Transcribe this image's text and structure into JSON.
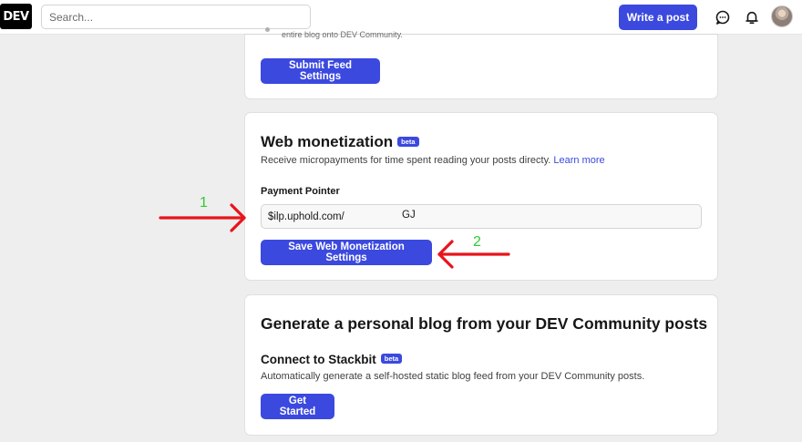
{
  "header": {
    "logo": "DEV",
    "search_placeholder": "Search...",
    "write_post": "Write a post"
  },
  "feed_card": {
    "faded_text": "entire blog onto DEV Community.",
    "submit": "Submit Feed Settings"
  },
  "monetization": {
    "title": "Web monetization",
    "badge": "beta",
    "description": "Receive micropayments for time spent reading your posts directy.",
    "learn_more": "Learn more",
    "pointer_label": "Payment Pointer",
    "pointer_value_start": "$ilp.uphold.com/",
    "pointer_value_end": "GJ",
    "save": "Save Web Monetization Settings"
  },
  "personal_blog": {
    "title": "Generate a personal blog from your DEV Community posts",
    "stackbit_title": "Connect to Stackbit",
    "badge": "beta",
    "description": "Automatically generate a self-hosted static blog feed from your DEV Community posts.",
    "get_started": "Get Started"
  },
  "annotations": {
    "label_1": "1",
    "label_2": "2",
    "arrow_color": "#e8141b",
    "number_color": "#2ecc2e"
  },
  "colors": {
    "brand": "#3b49df",
    "page_bg": "#eeeeee"
  }
}
